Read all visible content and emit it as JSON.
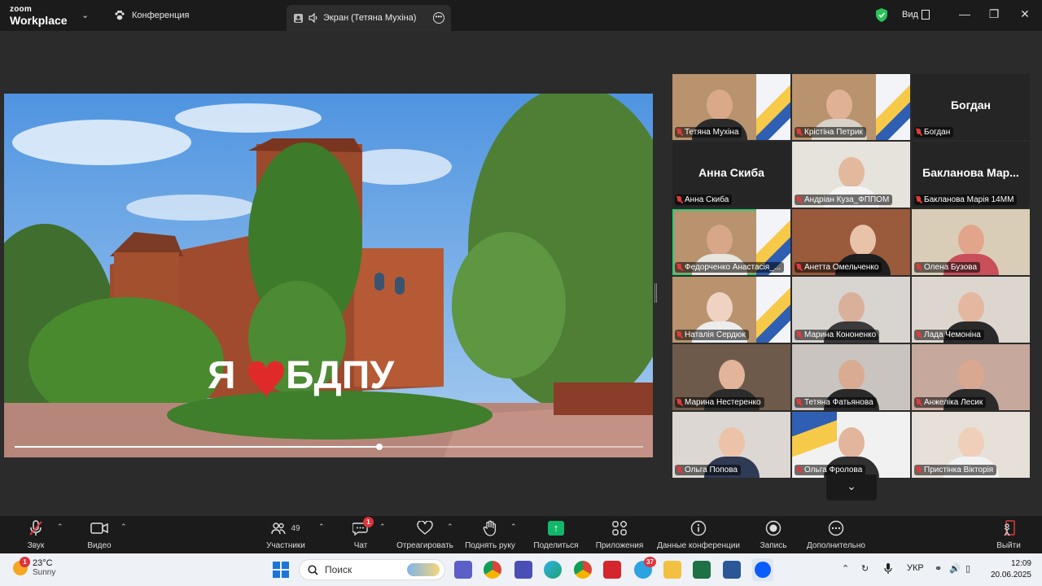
{
  "titlebar": {
    "logo_line1": "zoom",
    "logo_line2": "Workplace",
    "meeting_tab": "Конференция",
    "screen_tab": "Экран (Тетяна Мухіна)",
    "view_label": "Вид"
  },
  "shared_screen": {
    "sign_text": "Я❤БДПУ",
    "progress_fraction": 0.58
  },
  "participants": [
    {
      "name": "Тетяна Мухіна",
      "display": "video"
    },
    {
      "name": "Крістіна Петрик",
      "display": "video"
    },
    {
      "name": "Богдан",
      "display": "name"
    },
    {
      "name": "Анна Скиба",
      "display": "name"
    },
    {
      "name": "Андріан Куза_ФППОМ",
      "display": "video"
    },
    {
      "name": "Бакланова Марія 14ММ",
      "display": "name",
      "big_text": "Бакланова Мар..."
    },
    {
      "name": "Федорченко Анастасія_...",
      "display": "video",
      "active": true
    },
    {
      "name": "Анетта Омельченко",
      "display": "video"
    },
    {
      "name": "Олена Бузова",
      "display": "video"
    },
    {
      "name": "Наталія Сердюк",
      "display": "video"
    },
    {
      "name": "Марина Кононенко",
      "display": "video"
    },
    {
      "name": "Лада Чемоніна",
      "display": "video"
    },
    {
      "name": "Марина Нестеренко",
      "display": "video"
    },
    {
      "name": "Тетяна Фатьянова",
      "display": "video"
    },
    {
      "name": "Анжеліка Лесик",
      "display": "video"
    },
    {
      "name": "Ольга Попова",
      "display": "video"
    },
    {
      "name": "Ольга Фролова",
      "display": "video"
    },
    {
      "name": "Пристінка Вікторія",
      "display": "video"
    }
  ],
  "toolbar": {
    "audio": "Звук",
    "video": "Видео",
    "participants": "Участники",
    "participants_count": "49",
    "chat": "Чат",
    "chat_badge": "1",
    "react": "Отреагировать",
    "raise_hand": "Поднять руку",
    "share": "Поделиться",
    "apps": "Приложения",
    "meeting_info": "Данные конференции",
    "record": "Запись",
    "more": "Дополнительно",
    "leave": "Выйти"
  },
  "taskbar": {
    "weather_temp": "23°C",
    "weather_desc": "Sunny",
    "weather_badge": "1",
    "search_placeholder": "Поиск",
    "telegram_badge": "37",
    "language": "УКР",
    "time": "12:09",
    "date": "20.06.2025"
  },
  "colors": {
    "active_speaker": "#2ecc71",
    "badge_red": "#e0323a",
    "share_green": "#12b76a",
    "muted_red": "#e03b3b"
  }
}
